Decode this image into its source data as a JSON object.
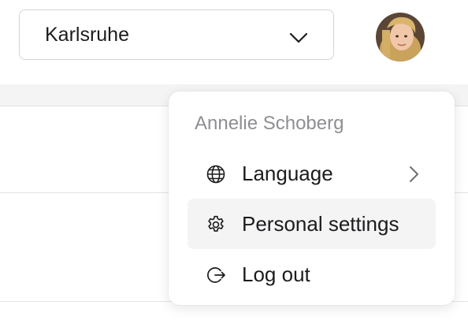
{
  "location": {
    "selected": "Karlsruhe"
  },
  "user": {
    "name": "Annelie Schoberg"
  },
  "menu": {
    "items": [
      {
        "label": "Language",
        "icon": "globe-icon",
        "has_submenu": true
      },
      {
        "label": "Personal settings",
        "icon": "gear-icon",
        "active": true
      },
      {
        "label": "Log out",
        "icon": "logout-icon"
      }
    ]
  },
  "colors": {
    "active_item_bg": "#f4f4f5",
    "muted_text": "#8e8e93",
    "border": "#d4d4d8"
  }
}
